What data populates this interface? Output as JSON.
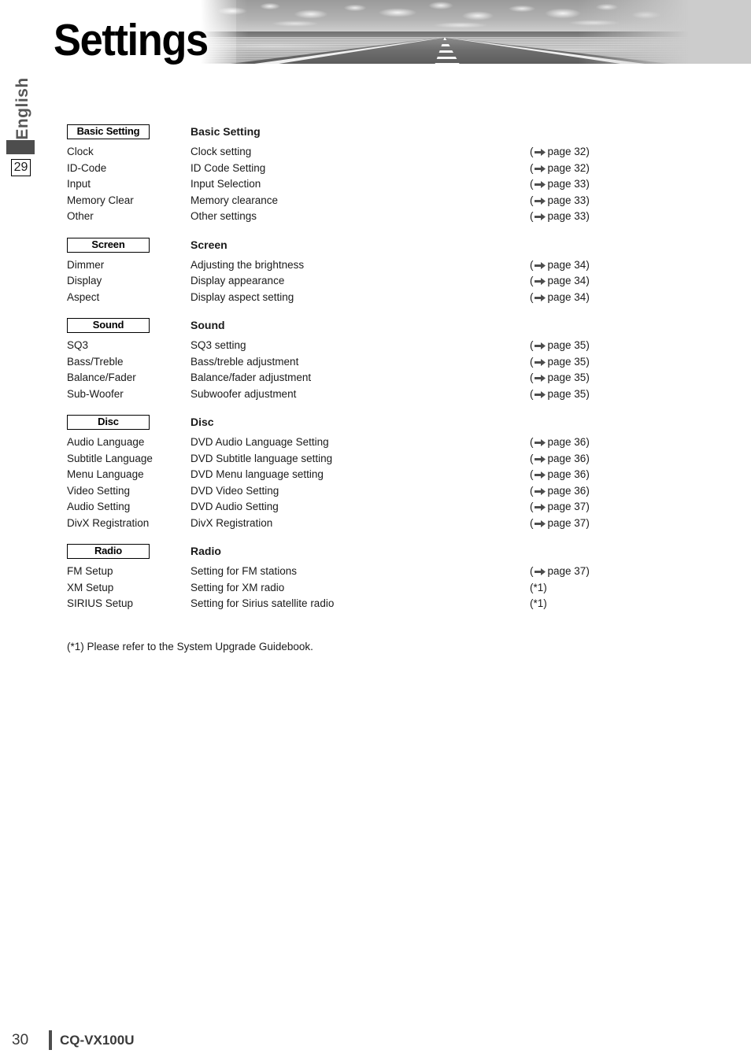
{
  "header": {
    "title": "Settings",
    "banner_icon": "desert-road-photo"
  },
  "side_rail": {
    "language_label": "English",
    "chapter_number": "29"
  },
  "groups": [
    {
      "badge": "Basic Setting",
      "title": "Basic Setting",
      "rows": [
        {
          "name": "Clock",
          "desc": "Clock setting",
          "ref": "page 32",
          "has_arrow": true
        },
        {
          "name": "ID-Code",
          "desc": "ID Code Setting",
          "ref": "page 32",
          "has_arrow": true
        },
        {
          "name": "Input",
          "desc": "Input Selection",
          "ref": "page 33",
          "has_arrow": true
        },
        {
          "name": "Memory Clear",
          "desc": "Memory clearance",
          "ref": "page 33",
          "has_arrow": true
        },
        {
          "name": "Other",
          "desc": "Other settings",
          "ref": "page 33",
          "has_arrow": true
        }
      ]
    },
    {
      "badge": "Screen",
      "title": "Screen",
      "rows": [
        {
          "name": "Dimmer",
          "desc": "Adjusting the brightness",
          "ref": "page 34",
          "has_arrow": true
        },
        {
          "name": "Display",
          "desc": "Display appearance",
          "ref": "page 34",
          "has_arrow": true
        },
        {
          "name": "Aspect",
          "desc": "Display aspect setting",
          "ref": "page 34",
          "has_arrow": true
        }
      ]
    },
    {
      "badge": "Sound",
      "title": "Sound",
      "rows": [
        {
          "name": "SQ3",
          "desc": "SQ3 setting",
          "ref": "page 35",
          "has_arrow": true
        },
        {
          "name": "Bass/Treble",
          "desc": "Bass/treble adjustment",
          "ref": "page 35",
          "has_arrow": true
        },
        {
          "name": "Balance/Fader",
          "desc": "Balance/fader adjustment",
          "ref": "page 35",
          "has_arrow": true
        },
        {
          "name": "Sub-Woofer",
          "desc": "Subwoofer adjustment",
          "ref": "page 35",
          "has_arrow": true
        }
      ]
    },
    {
      "badge": "Disc",
      "title": "Disc",
      "rows": [
        {
          "name": "Audio Language",
          "desc": "DVD Audio Language Setting",
          "ref": "page 36",
          "has_arrow": true
        },
        {
          "name": "Subtitle Language",
          "desc": "DVD Subtitle language setting",
          "ref": "page 36",
          "has_arrow": true
        },
        {
          "name": "Menu Language",
          "desc": "DVD Menu language setting",
          "ref": "page 36",
          "has_arrow": true
        },
        {
          "name": "Video Setting",
          "desc": "DVD Video Setting",
          "ref": "page 36",
          "has_arrow": true
        },
        {
          "name": "Audio Setting",
          "desc": "DVD Audio Setting",
          "ref": "page 37",
          "has_arrow": true
        },
        {
          "name": "DivX Registration",
          "desc": "DivX Registration",
          "ref": "page 37",
          "has_arrow": true
        }
      ]
    },
    {
      "badge": "Radio",
      "title": "Radio",
      "rows": [
        {
          "name": "FM Setup",
          "desc": "Setting for FM stations",
          "ref": "page 37",
          "has_arrow": true
        },
        {
          "name": "XM Setup",
          "desc": "Setting for XM radio",
          "ref": "*1",
          "has_arrow": false
        },
        {
          "name": "SIRIUS Setup",
          "desc": "Setting for Sirius satellite radio",
          "ref": "*1",
          "has_arrow": false
        }
      ]
    }
  ],
  "footnote": "(*1) Please refer to the System Upgrade Guidebook.",
  "footer": {
    "page_number": "30",
    "model": "CQ-VX100U"
  }
}
